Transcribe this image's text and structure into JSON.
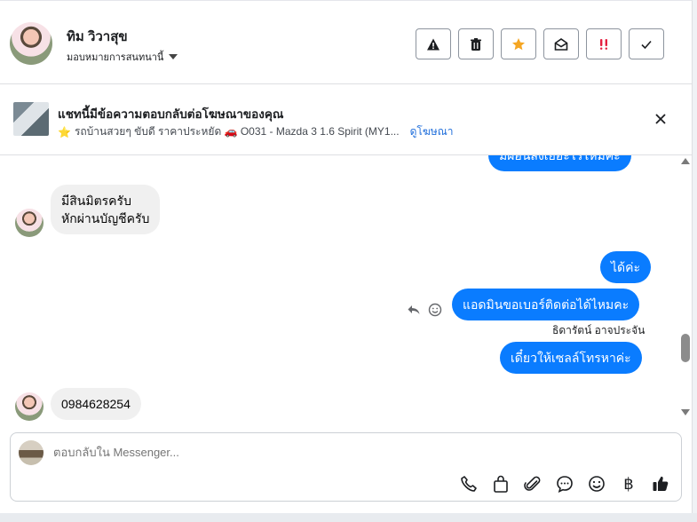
{
  "header": {
    "name": "ทิม วิวาสุข",
    "assign_label": "มอบหมายการสนทนานี้",
    "actions": [
      {
        "icon": "warning-icon",
        "glyph": "⚠"
      },
      {
        "icon": "trash-icon"
      },
      {
        "icon": "star-icon",
        "glyph": "★",
        "color": "#f5a623"
      },
      {
        "icon": "envelope-open-icon"
      },
      {
        "icon": "exclamation-icon",
        "glyph": "!!",
        "color": "#e41e3f"
      },
      {
        "icon": "check-icon",
        "glyph": "✓"
      }
    ]
  },
  "ad": {
    "title": "แชทนี้มีข้อความตอบกลับต่อโฆษณาของคุณ",
    "star": "⭐",
    "subtitle": "รถบ้านสวยๆ ขับดี ราคาประหยัด 🚗 O031 - Mazda 3 1.6 Spirit (MY1...",
    "link": "ดูโฆษณา"
  },
  "messages": {
    "partial_top": "มีผ่อนส่งเยอะไรไหมคะ",
    "in1_line1": "มีสินมิตรครับ",
    "in1_line2": "หักผ่านบัญชีครับ",
    "out1": "ได้ค่ะ",
    "out2": "แอดมินขอเบอร์ติดต่อได้ไหมคะ",
    "sender": "ธิดารัตน์ อาจประจัน",
    "out3": "เดี๋ยวให้เซลล์โทรหาค่ะ",
    "in2": "0984628254"
  },
  "composer": {
    "placeholder": "ตอบกลับใน Messenger...",
    "baht": "฿"
  },
  "colors": {
    "outgoing": "#0a7cff",
    "incoming": "#f0f0f0",
    "link": "#216fdb"
  }
}
